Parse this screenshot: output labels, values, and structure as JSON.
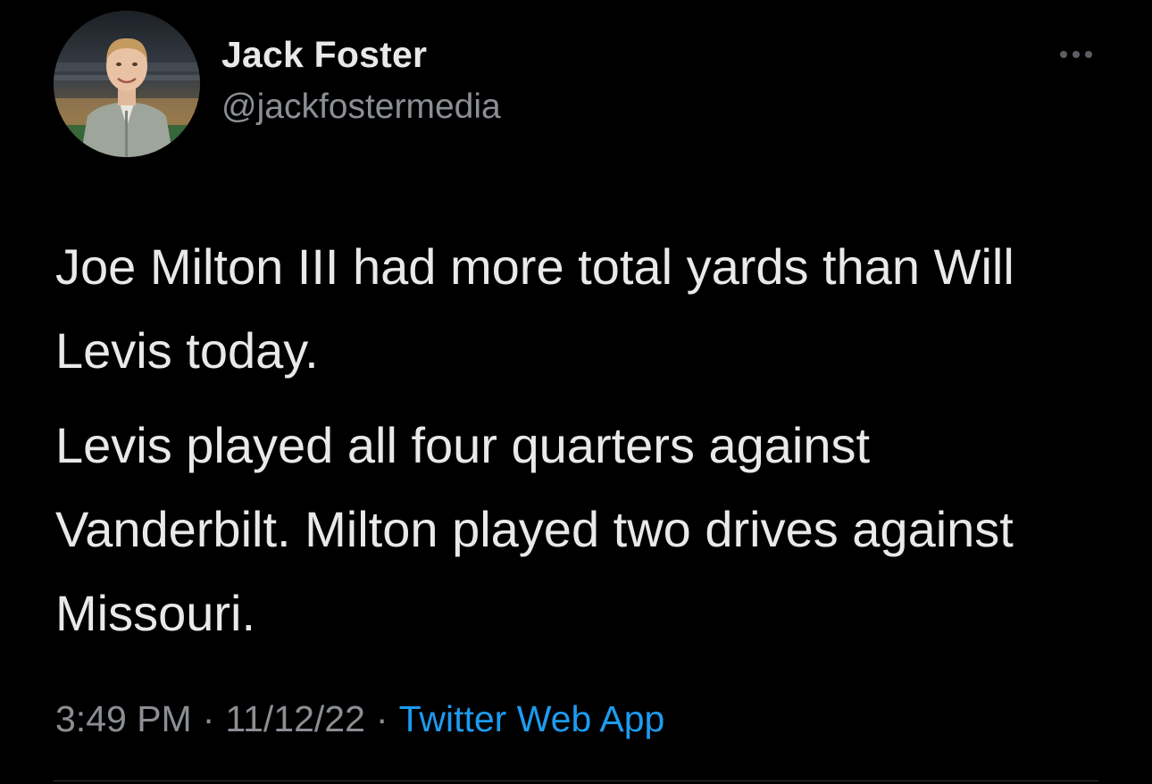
{
  "user": {
    "display_name": "Jack Foster",
    "handle": "@jackfostermedia",
    "avatar": "profile-photo"
  },
  "tweet": {
    "paragraphs": [
      "Joe Milton III had more total yards than Will Levis today.",
      "Levis played all four quarters against Vanderbilt. Milton played two drives against Missouri."
    ]
  },
  "meta": {
    "time": "3:49 PM",
    "separator": "·",
    "date": "11/12/22",
    "source": "Twitter Web App"
  },
  "icons": {
    "more": "more-options-icon"
  },
  "colors": {
    "background": "#000000",
    "text": "#e7e9ea",
    "secondary_text": "#8b8f94",
    "link": "#1d9bf0"
  }
}
